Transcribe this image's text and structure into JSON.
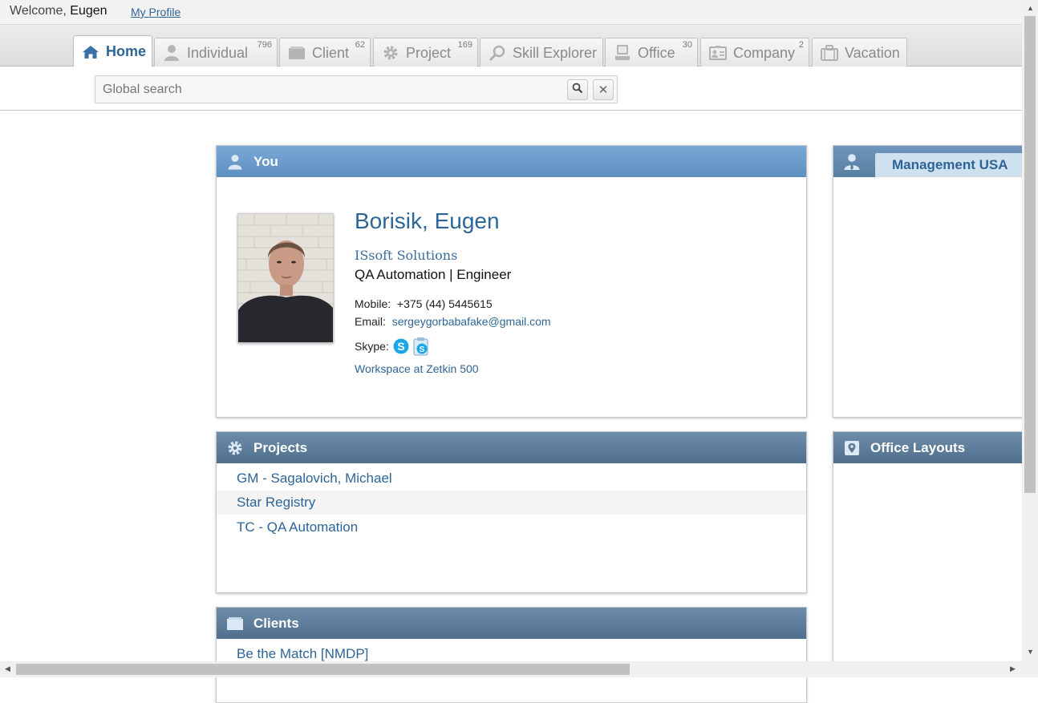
{
  "header": {
    "welcome_prefix": "Welcome,",
    "user_first_name": "Eugen",
    "my_profile": "My Profile"
  },
  "tabs": [
    {
      "label": "Home",
      "count": "",
      "icon": "home-icon",
      "active": true
    },
    {
      "label": "Individual",
      "count": "796",
      "icon": "person-icon"
    },
    {
      "label": "Client",
      "count": "62",
      "icon": "folder-icon"
    },
    {
      "label": "Project",
      "count": "169",
      "icon": "gear-icon"
    },
    {
      "label": "Skill Explorer",
      "count": "",
      "icon": "magnifier-icon"
    },
    {
      "label": "Office",
      "count": "30",
      "icon": "computer-icon"
    },
    {
      "label": "Company",
      "count": "2",
      "icon": "id-card-icon"
    },
    {
      "label": "Vacation",
      "count": "",
      "icon": "suitcase-icon"
    }
  ],
  "search": {
    "placeholder": "Global search",
    "value": "",
    "clear_symbol": "✕"
  },
  "you_panel": {
    "title": "You",
    "name": "Borisik, Eugen",
    "company": "ISsoft Solutions",
    "role": "QA Automation | Engineer",
    "mobile_label": "Mobile:",
    "mobile": "+375 (44) 5445615",
    "email_label": "Email:",
    "email": "sergeygorbabafake@gmail.com",
    "skype_label": "Skype:",
    "workspace": "Workspace at Zetkin 500"
  },
  "projects_panel": {
    "title": "Projects",
    "items": [
      "GM - Sagalovich, Michael",
      "Star Registry",
      "TC - QA Automation"
    ]
  },
  "clients_panel": {
    "title": "Clients",
    "items": [
      "Be the Match [NMDP]"
    ]
  },
  "management_panel": {
    "tab_label": "Management USA"
  },
  "office_layouts_panel": {
    "title": "Office Layouts"
  },
  "colors": {
    "link": "#2e6597",
    "panel_header_light": "#6a9bcb",
    "panel_header_dark": "#5a7a98"
  }
}
